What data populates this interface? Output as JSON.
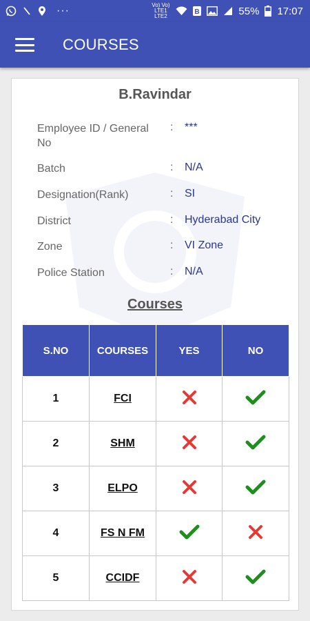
{
  "status_bar": {
    "left_icons": [
      "whatsapp-icon",
      "phone-missed-icon",
      "location-icon",
      "more-dots-icon"
    ],
    "dots": "···",
    "net_label_top": "Vo) Vo)",
    "net_label_bottom": "LTE1 LTE2",
    "battery_percent": "55%",
    "time": "17:07"
  },
  "app_bar": {
    "title": "COURSES",
    "menu_icon": "hamburger-menu-icon"
  },
  "profile": {
    "name": "B.Ravindar",
    "fields": [
      {
        "label": "Employee ID / General No",
        "value": "***"
      },
      {
        "label": "Batch",
        "value": "N/A"
      },
      {
        "label": "Designation(Rank)",
        "value": "SI"
      },
      {
        "label": "District",
        "value": "Hyderabad City"
      },
      {
        "label": "Zone",
        "value": "VI Zone"
      },
      {
        "label": "Police Station",
        "value": "N/A"
      }
    ],
    "separator": ":"
  },
  "courses": {
    "heading": "Courses",
    "columns": [
      "S.NO",
      "COURSES",
      "YES",
      "NO"
    ],
    "rows": [
      {
        "sno": "1",
        "course": "FCI",
        "yes": false,
        "no": true
      },
      {
        "sno": "2",
        "course": "SHM",
        "yes": false,
        "no": true
      },
      {
        "sno": "3",
        "course": "ELPO",
        "yes": false,
        "no": true
      },
      {
        "sno": "4",
        "course": "FS N FM",
        "yes": true,
        "no": false
      },
      {
        "sno": "5",
        "course": "CCIDF",
        "yes": false,
        "no": true
      }
    ]
  },
  "colors": {
    "primary": "#3f51b5",
    "check": "#1e8e1e",
    "cross": "#e53935",
    "value_text": "#283593"
  }
}
